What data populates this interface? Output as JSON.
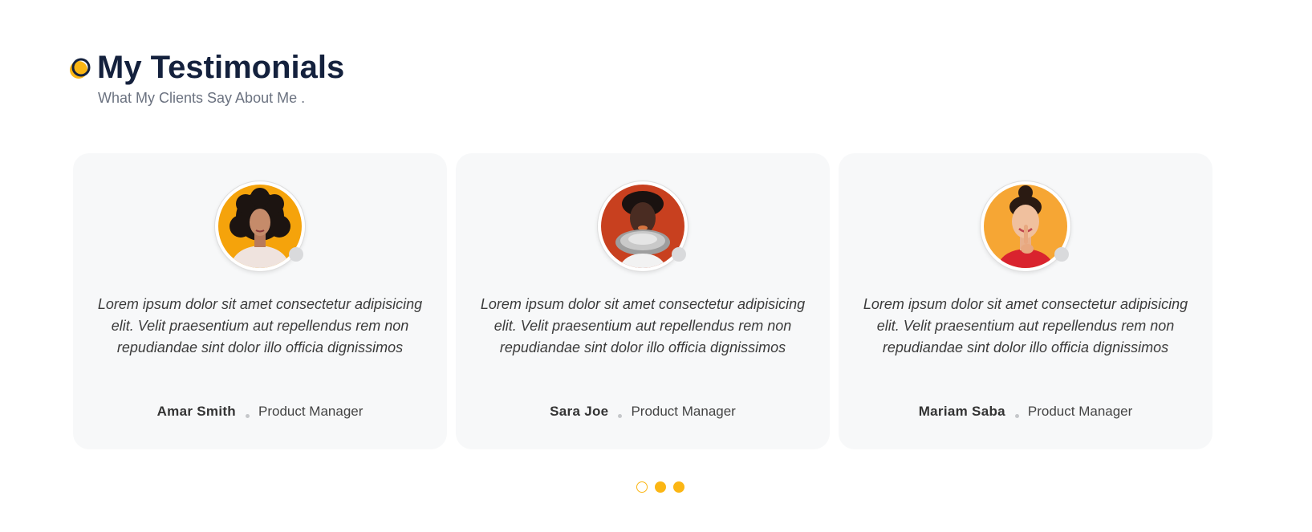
{
  "section": {
    "title": "My Testimonials",
    "subtitle": "What My Clients Say About Me .",
    "accent_color": "#fbb614",
    "heading_icon": "circle-badge-icon"
  },
  "testimonials": [
    {
      "quote": "Lorem ipsum dolor sit amet consectetur adipisicing elit. Velit praesentium aut repellendus rem non repudiandae sint dolor illo officia dignissimos",
      "name": "Amar Smith",
      "role": "Product Manager",
      "avatar_background": "#f5a30b"
    },
    {
      "quote": "Lorem ipsum dolor sit amet consectetur adipisicing elit. Velit praesentium aut repellendus rem non repudiandae sint dolor illo officia dignissimos",
      "name": "Sara Joe",
      "role": "Product Manager",
      "avatar_background": "#c8401f"
    },
    {
      "quote": "Lorem ipsum dolor sit amet consectetur adipisicing elit. Velit praesentium aut repellendus rem non repudiandae sint dolor illo officia dignissimos",
      "name": "Mariam Saba",
      "role": "Product Manager",
      "avatar_background": "#f6a634"
    }
  ],
  "pagination": {
    "page_count": 3,
    "active_index": 0,
    "color": "#fbb614"
  }
}
